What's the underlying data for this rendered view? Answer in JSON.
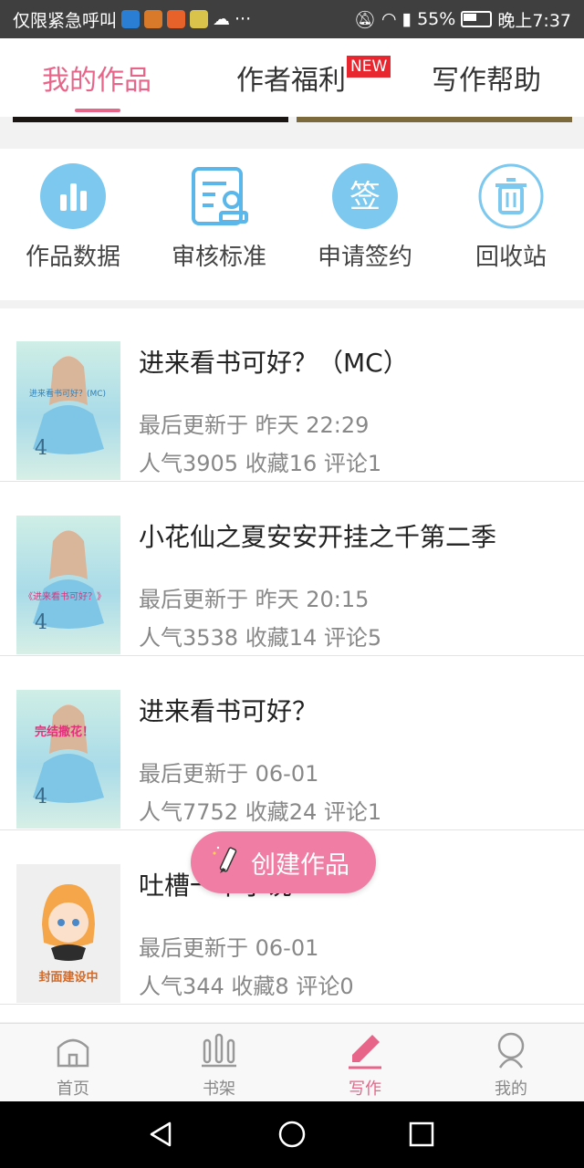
{
  "status_bar": {
    "carrier": "仅限紧急呼叫",
    "more": "···",
    "battery": "55%",
    "time": "晚上7:37"
  },
  "tabs": [
    {
      "label": "我的作品"
    },
    {
      "label": "作者福利",
      "badge": "NEW"
    },
    {
      "label": "写作帮助"
    }
  ],
  "quick_actions": [
    {
      "label": "作品数据",
      "icon": "bar-chart-icon"
    },
    {
      "label": "审核标准",
      "icon": "review-doc-icon"
    },
    {
      "label": "申请签约",
      "icon": "sign-icon",
      "icon_text": "签"
    },
    {
      "label": "回收站",
      "icon": "trash-icon"
    }
  ],
  "works": [
    {
      "title": "进来看书可好？（MC）",
      "updated": "最后更新于 昨天 22:29",
      "stats": "人气3905 收藏16 评论1"
    },
    {
      "title": "小花仙之夏安安开挂之千第二季",
      "updated": "最后更新于 昨天 20:15",
      "stats": "人气3538 收藏14 评论5"
    },
    {
      "title": "进来看书可好？",
      "updated": "最后更新于 06-01",
      "stats": "人气7752 收藏24 评论1"
    },
    {
      "title": "吐槽一本小说",
      "updated": "最后更新于 06-01",
      "stats": "人气344 收藏8 评论0"
    }
  ],
  "covers": {
    "cover1_text": "进来看书可好？(MC)",
    "cover1_num": "4",
    "cover2_text": "《进来看书可好？》",
    "cover2_num": "4",
    "cover3_text": "完结撒花！",
    "cover3_num": "4",
    "cover4_text": "封面建设中"
  },
  "fab": {
    "label": "创建作品"
  },
  "bottom_nav": [
    {
      "label": "首页"
    },
    {
      "label": "书架"
    },
    {
      "label": "写作"
    },
    {
      "label": "我的"
    }
  ],
  "colors": {
    "accent": "#e8658a",
    "fab": "#f07ea4",
    "icon_blue": "#5bb6ea"
  }
}
